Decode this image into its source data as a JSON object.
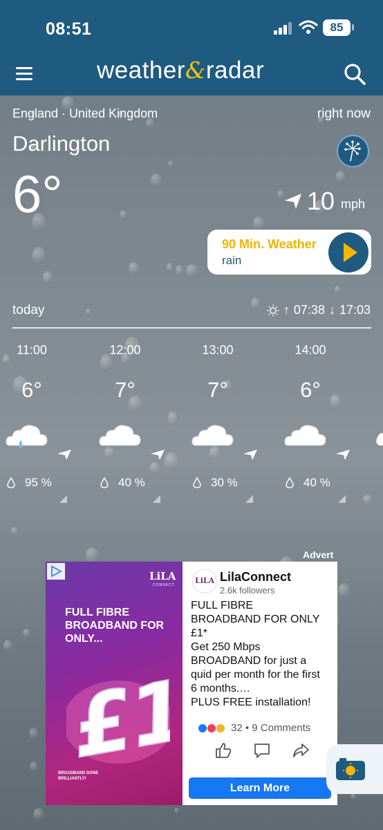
{
  "status_bar": {
    "time": "08:51",
    "battery": "85"
  },
  "header": {
    "logo_left": "weather",
    "logo_amp": "&",
    "logo_right": "radar"
  },
  "current": {
    "region": "England · United Kingdom",
    "time_label": "right now",
    "city": "Darlington",
    "temperature": "6°",
    "wind_speed": "10",
    "wind_unit": "mph"
  },
  "min90": {
    "title": "90 Min. Weather",
    "subtitle": "rain"
  },
  "day": {
    "label": "today",
    "sunrise": "07:38",
    "sunset": "17:03"
  },
  "hourly": [
    {
      "time": "11:00",
      "temp": "6°",
      "icon": "cloud-rain-icon",
      "precip": "95 %"
    },
    {
      "time": "12:00",
      "temp": "7°",
      "icon": "cloud-icon",
      "precip": "40 %"
    },
    {
      "time": "13:00",
      "temp": "7°",
      "icon": "cloud-icon",
      "precip": "30 %"
    },
    {
      "time": "14:00",
      "temp": "6°",
      "icon": "cloud-icon",
      "precip": "40 %"
    }
  ],
  "advert": {
    "label": "Advert",
    "image": {
      "brand": "LiLA",
      "brand_sub": "CONNECT",
      "headline": "FULL FIBRE BROADBAND FOR ONLY...",
      "price": "£1",
      "footer": "BROADBAND DONE BRILLIANTLY!"
    },
    "avatar_text": "LiLA",
    "page_name": "LilaConnect",
    "followers": "2.6k followers",
    "body_lines": [
      "FULL FIBRE",
      "BROADBAND FOR ONLY",
      "£1*",
      "Get 250 Mbps",
      "BROADBAND for just a",
      "quid per month for the first",
      "6 months.…",
      "PLUS FREE installation!"
    ],
    "reactions": "32 • 9 Comments",
    "cta": "Learn More"
  },
  "colors": {
    "header": "#1f5a80",
    "accent": "#f0b400",
    "cta": "#1877f2"
  }
}
